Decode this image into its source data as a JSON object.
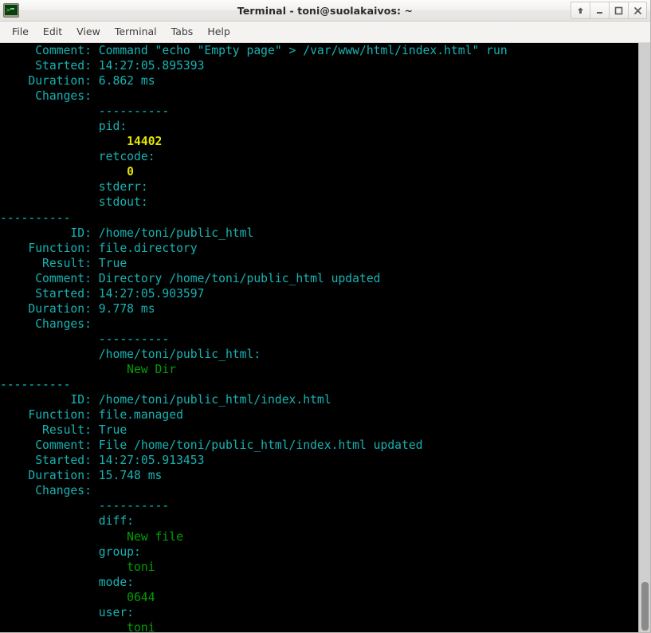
{
  "window": {
    "title": "Terminal - toni@suolakaivos: ~",
    "icon": "terminal-icon",
    "buttons": [
      {
        "name": "shade-button",
        "label": "Shade"
      },
      {
        "name": "minimize-button",
        "label": "Minimize"
      },
      {
        "name": "maximize-button",
        "label": "Maximize"
      },
      {
        "name": "close-button",
        "label": "Close"
      }
    ]
  },
  "menubar": {
    "items": [
      {
        "label": "File"
      },
      {
        "label": "Edit"
      },
      {
        "label": "View"
      },
      {
        "label": "Terminal"
      },
      {
        "label": "Tabs"
      },
      {
        "label": "Help"
      }
    ]
  },
  "terminal": {
    "colors": {
      "background": "#000000",
      "cyan": "#18b2b2",
      "bright_cyan": "#00cdcd",
      "yellow": "#e5e500",
      "green": "#00a000"
    },
    "lines": [
      [
        {
          "t": "     Comment: Command \"echo \"Empty page\" > /var/www/html/index.html\" run",
          "c": "c-cyan"
        }
      ],
      [
        {
          "t": "     Started: 14:27:05.895393",
          "c": "c-cyan"
        }
      ],
      [
        {
          "t": "    Duration: 6.862 ms",
          "c": "c-cyan"
        }
      ],
      [
        {
          "t": "     Changes:",
          "c": "c-cyan"
        }
      ],
      [
        {
          "t": "              ----------",
          "c": "c-dash"
        }
      ],
      [
        {
          "t": "              pid:",
          "c": "c-cyan"
        }
      ],
      [
        {
          "t": "                  ",
          "c": "c-cyan"
        },
        {
          "t": "14402",
          "c": "c-yellow"
        }
      ],
      [
        {
          "t": "              retcode:",
          "c": "c-cyan"
        }
      ],
      [
        {
          "t": "                  ",
          "c": "c-cyan"
        },
        {
          "t": "0",
          "c": "c-yellow"
        }
      ],
      [
        {
          "t": "              stderr:",
          "c": "c-cyan"
        }
      ],
      [
        {
          "t": "              stdout:",
          "c": "c-cyan"
        }
      ],
      [
        {
          "t": "----------",
          "c": "c-dash"
        }
      ],
      [
        {
          "t": "          ID: /home/toni/public_html",
          "c": "c-cyan"
        }
      ],
      [
        {
          "t": "    Function: file.directory",
          "c": "c-cyan"
        }
      ],
      [
        {
          "t": "      Result: True",
          "c": "c-cyan"
        }
      ],
      [
        {
          "t": "     Comment: Directory /home/toni/public_html updated",
          "c": "c-cyan"
        }
      ],
      [
        {
          "t": "     Started: 14:27:05.903597",
          "c": "c-cyan"
        }
      ],
      [
        {
          "t": "    Duration: 9.778 ms",
          "c": "c-cyan"
        }
      ],
      [
        {
          "t": "     Changes:",
          "c": "c-cyan"
        }
      ],
      [
        {
          "t": "              ----------",
          "c": "c-dash"
        }
      ],
      [
        {
          "t": "              /home/toni/public_html:",
          "c": "c-cyan"
        }
      ],
      [
        {
          "t": "                  ",
          "c": "c-cyan"
        },
        {
          "t": "New Dir",
          "c": "c-green"
        }
      ],
      [
        {
          "t": "----------",
          "c": "c-dash"
        }
      ],
      [
        {
          "t": "          ID: /home/toni/public_html/index.html",
          "c": "c-cyan"
        }
      ],
      [
        {
          "t": "    Function: file.managed",
          "c": "c-cyan"
        }
      ],
      [
        {
          "t": "      Result: True",
          "c": "c-cyan"
        }
      ],
      [
        {
          "t": "     Comment: File /home/toni/public_html/index.html updated",
          "c": "c-cyan"
        }
      ],
      [
        {
          "t": "     Started: 14:27:05.913453",
          "c": "c-cyan"
        }
      ],
      [
        {
          "t": "    Duration: 15.748 ms",
          "c": "c-cyan"
        }
      ],
      [
        {
          "t": "     Changes:",
          "c": "c-cyan"
        }
      ],
      [
        {
          "t": "              ----------",
          "c": "c-dash"
        }
      ],
      [
        {
          "t": "              diff:",
          "c": "c-cyan"
        }
      ],
      [
        {
          "t": "                  ",
          "c": "c-cyan"
        },
        {
          "t": "New file",
          "c": "c-green"
        }
      ],
      [
        {
          "t": "              group:",
          "c": "c-cyan"
        }
      ],
      [
        {
          "t": "                  ",
          "c": "c-cyan"
        },
        {
          "t": "toni",
          "c": "c-green"
        }
      ],
      [
        {
          "t": "              mode:",
          "c": "c-cyan"
        }
      ],
      [
        {
          "t": "                  ",
          "c": "c-cyan"
        },
        {
          "t": "0644",
          "c": "c-green"
        }
      ],
      [
        {
          "t": "              user:",
          "c": "c-cyan"
        }
      ],
      [
        {
          "t": "                  ",
          "c": "c-cyan"
        },
        {
          "t": "toni",
          "c": "c-green"
        }
      ]
    ]
  },
  "scrollbar": {
    "thumb_top_pct": 91.5,
    "thumb_height_pct": 8.2
  }
}
